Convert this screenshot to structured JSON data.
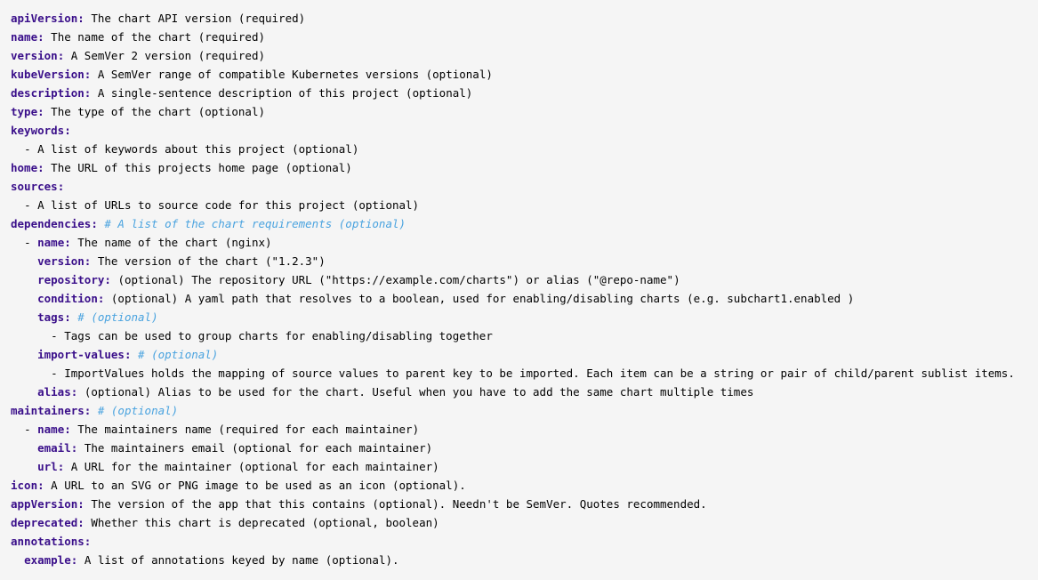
{
  "lines": [
    {
      "indent": 0,
      "dash": false,
      "key": "apiVersion",
      "value": "The chart API version (required)"
    },
    {
      "indent": 0,
      "dash": false,
      "key": "name",
      "value": "The name of the chart (required)"
    },
    {
      "indent": 0,
      "dash": false,
      "key": "version",
      "value": "A SemVer 2 version (required)"
    },
    {
      "indent": 0,
      "dash": false,
      "key": "kubeVersion",
      "value": "A SemVer range of compatible Kubernetes versions (optional)"
    },
    {
      "indent": 0,
      "dash": false,
      "key": "description",
      "value": "A single-sentence description of this project (optional)"
    },
    {
      "indent": 0,
      "dash": false,
      "key": "type",
      "value": "The type of the chart (optional)"
    },
    {
      "indent": 0,
      "dash": false,
      "key": "keywords",
      "value": ""
    },
    {
      "indent": 2,
      "dash": true,
      "key": "",
      "value": "A list of keywords about this project (optional)"
    },
    {
      "indent": 0,
      "dash": false,
      "key": "home",
      "value": "The URL of this projects home page (optional)"
    },
    {
      "indent": 0,
      "dash": false,
      "key": "sources",
      "value": ""
    },
    {
      "indent": 2,
      "dash": true,
      "key": "",
      "value": "A list of URLs to source code for this project (optional)"
    },
    {
      "indent": 0,
      "dash": false,
      "key": "dependencies",
      "value": "",
      "comment": "# A list of the chart requirements (optional)"
    },
    {
      "indent": 2,
      "dash": true,
      "key": "name",
      "value": "The name of the chart (nginx)"
    },
    {
      "indent": 4,
      "dash": false,
      "key": "version",
      "value": "The version of the chart (\"1.2.3\")"
    },
    {
      "indent": 4,
      "dash": false,
      "key": "repository",
      "value": "(optional) The repository URL (\"https://example.com/charts\") or alias (\"@repo-name\")"
    },
    {
      "indent": 4,
      "dash": false,
      "key": "condition",
      "value": "(optional) A yaml path that resolves to a boolean, used for enabling/disabling charts (e.g. subchart1.enabled )"
    },
    {
      "indent": 4,
      "dash": false,
      "key": "tags",
      "value": "",
      "comment": "# (optional)"
    },
    {
      "indent": 6,
      "dash": true,
      "key": "",
      "value": "Tags can be used to group charts for enabling/disabling together"
    },
    {
      "indent": 4,
      "dash": false,
      "key": "import-values",
      "value": "",
      "comment": "# (optional)"
    },
    {
      "indent": 6,
      "dash": true,
      "key": "",
      "value": "ImportValues holds the mapping of source values to parent key to be imported. Each item can be a string or pair of child/parent sublist items."
    },
    {
      "indent": 4,
      "dash": false,
      "key": "alias",
      "value": "(optional) Alias to be used for the chart. Useful when you have to add the same chart multiple times"
    },
    {
      "indent": 0,
      "dash": false,
      "key": "maintainers",
      "value": "",
      "comment": "# (optional)"
    },
    {
      "indent": 2,
      "dash": true,
      "key": "name",
      "value": "The maintainers name (required for each maintainer)"
    },
    {
      "indent": 4,
      "dash": false,
      "key": "email",
      "value": "The maintainers email (optional for each maintainer)"
    },
    {
      "indent": 4,
      "dash": false,
      "key": "url",
      "value": "A URL for the maintainer (optional for each maintainer)"
    },
    {
      "indent": 0,
      "dash": false,
      "key": "icon",
      "value": "A URL to an SVG or PNG image to be used as an icon (optional)."
    },
    {
      "indent": 0,
      "dash": false,
      "key": "appVersion",
      "value": "The version of the app that this contains (optional). Needn't be SemVer. Quotes recommended."
    },
    {
      "indent": 0,
      "dash": false,
      "key": "deprecated",
      "value": "Whether this chart is deprecated (optional, boolean)"
    },
    {
      "indent": 0,
      "dash": false,
      "key": "annotations",
      "value": ""
    },
    {
      "indent": 2,
      "dash": false,
      "key": "example",
      "value": "A list of annotations keyed by name (optional)."
    }
  ]
}
